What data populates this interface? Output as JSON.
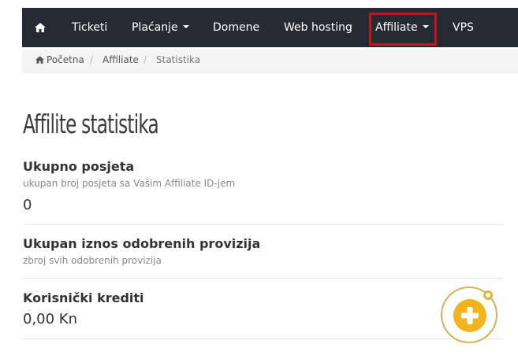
{
  "navbar": {
    "items": [
      {
        "label": "Ticketi"
      },
      {
        "label": "Plaćanje"
      },
      {
        "label": "Domene"
      },
      {
        "label": "Web hosting"
      },
      {
        "label": "Affiliate"
      },
      {
        "label": "VPS"
      }
    ],
    "home_icon": "home-icon",
    "highlight_color": "#c8141b"
  },
  "breadcrumb": {
    "items": [
      {
        "label": "Početna"
      },
      {
        "label": "Affiliate"
      },
      {
        "label": "Statistika"
      }
    ],
    "separator": "/"
  },
  "page": {
    "title": "Affilite statistika"
  },
  "stats": [
    {
      "title": "Ukupno posjeta",
      "description": "ukupan broj posjeta sa Vašim Affiliate ID-jem",
      "value": "0"
    },
    {
      "title": "Ukupan iznos odobrenih provizija",
      "description": "zbroj svih odobrenih provizija",
      "value": ""
    },
    {
      "title": "Korisnički krediti",
      "description": "",
      "value": "0,00 Kn"
    }
  ],
  "fab": {
    "icon": "plus-icon",
    "color": "#f2b41c"
  }
}
